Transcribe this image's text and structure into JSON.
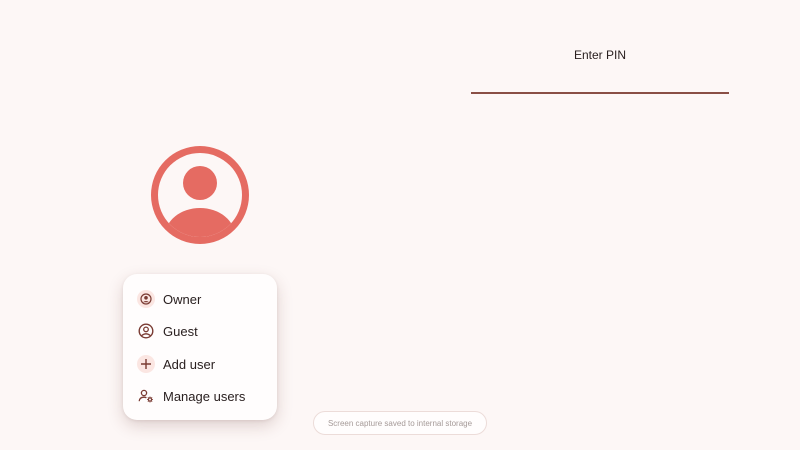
{
  "colors": {
    "background": "#fdf7f6",
    "accent": "#e56b62",
    "underline": "#8a4f45",
    "icon": "#7a3b33",
    "menu_background": "#fffdfd"
  },
  "pin": {
    "label": "Enter PIN",
    "value": ""
  },
  "avatar": {
    "icon": "account-circle-icon"
  },
  "user_menu": {
    "items": [
      {
        "label": "Owner",
        "icon": "account-circle-small-icon"
      },
      {
        "label": "Guest",
        "icon": "account-circle-outline-icon"
      },
      {
        "label": "Add user",
        "icon": "plus-icon"
      },
      {
        "label": "Manage users",
        "icon": "manage-accounts-icon"
      }
    ]
  },
  "toast": {
    "text": "Screen capture saved to internal storage"
  }
}
